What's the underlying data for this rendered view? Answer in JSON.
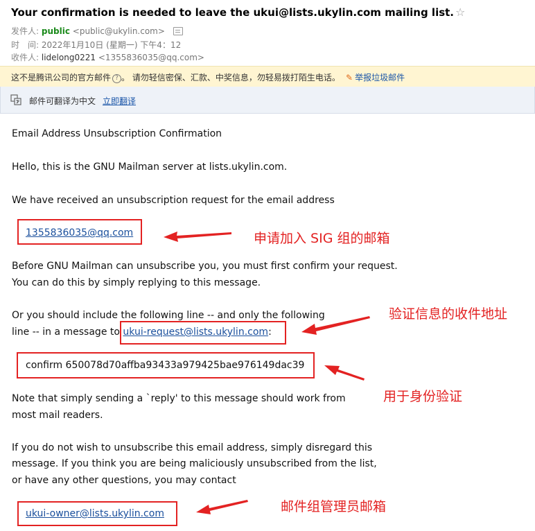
{
  "email": {
    "subject": "Your confirmation is needed to leave the ukui@lists.ukylin.com mailing list.",
    "from_label": "发件人:",
    "from_name": "public",
    "from_addr": "<public@ukylin.com>",
    "time_label": "时　间:",
    "time_value": "2022年1月10日 (星期一) 下午4：12",
    "to_label": "收件人:",
    "to_name": "lidelong0221",
    "to_addr": "<1355836035@qq.com>"
  },
  "warning": {
    "text1": "这不是腾讯公司的官方邮件",
    "text2": "。 请勿轻信密保、汇款、中奖信息，勿轻易拨打陌生电话。",
    "report": "举报垃圾邮件"
  },
  "translate": {
    "label": "邮件可翻译为中文",
    "action": "立即翻译"
  },
  "body": {
    "l1": "Email Address Unsubscription Confirmation",
    "l2": "Hello, this is the GNU Mailman server at lists.ukylin.com.",
    "l3": "We have received an unsubscription request for the email address",
    "email_link": "1355836035@qq.com",
    "l4": "Before GNU Mailman can unsubscribe you, you must first confirm your request.",
    "l5": "You can do this by simply replying to this message.",
    "l6": "Or you should include the following line -- and only the following",
    "l7_pre": "line -- in a message to ",
    "request_link": "ukui-request@lists.ukylin.com",
    "l7_post": ":",
    "confirm_line": "confirm 650078d70affba93433a979425bae976149dac39",
    "l8": "Note that simply sending a `reply' to this message should work from",
    "l9": "most mail readers.",
    "l10": "If you do not wish to unsubscribe this email address, simply disregard this",
    "l11": "message.  If you think you are being maliciously unsubscribed from the list,",
    "l12": "or have any other questions, you may contact",
    "owner_link": "ukui-owner@lists.ukylin.com"
  },
  "annotations": {
    "note1": "申请加入 SIG 组的邮箱",
    "note2": "验证信息的收件地址",
    "note3": "用于身份验证",
    "note4": "邮件组管理员邮箱",
    "color": "#e32222"
  }
}
